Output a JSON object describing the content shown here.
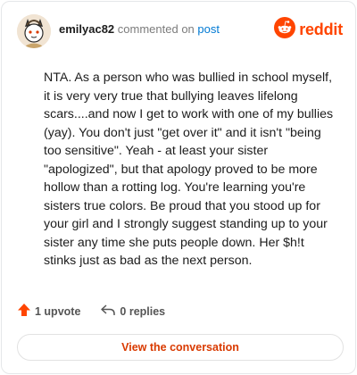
{
  "header": {
    "username": "emilyac82",
    "commented_text": "commented on",
    "post_link": "post",
    "brand": "reddit"
  },
  "comment": {
    "body": "NTA. As a person who was bullied in school myself, it is very very true that bullying leaves lifelong scars....and now I get to work with one of my bullies (yay). You don't just \"get over it\" and it isn't \"being too sensitive\". Yeah - at least your sister \"apologized\", but that apology proved to be more hollow than a rotting log. You're learning you're sisters true colors. Be proud that you stood up for your girl and I strongly suggest standing up to your sister any time she puts people down. Her $h!t stinks just as bad as the next person."
  },
  "actions": {
    "upvotes": "1 upvote",
    "replies": "0 replies"
  },
  "footer": {
    "view_label": "View the conversation"
  },
  "colors": {
    "brand": "#ff4500",
    "link": "#0079d3",
    "button_text": "#d93a00"
  },
  "icons": [
    "avatar",
    "reddit-logo-icon",
    "upvote-arrow-icon",
    "reply-arrow-icon"
  ]
}
